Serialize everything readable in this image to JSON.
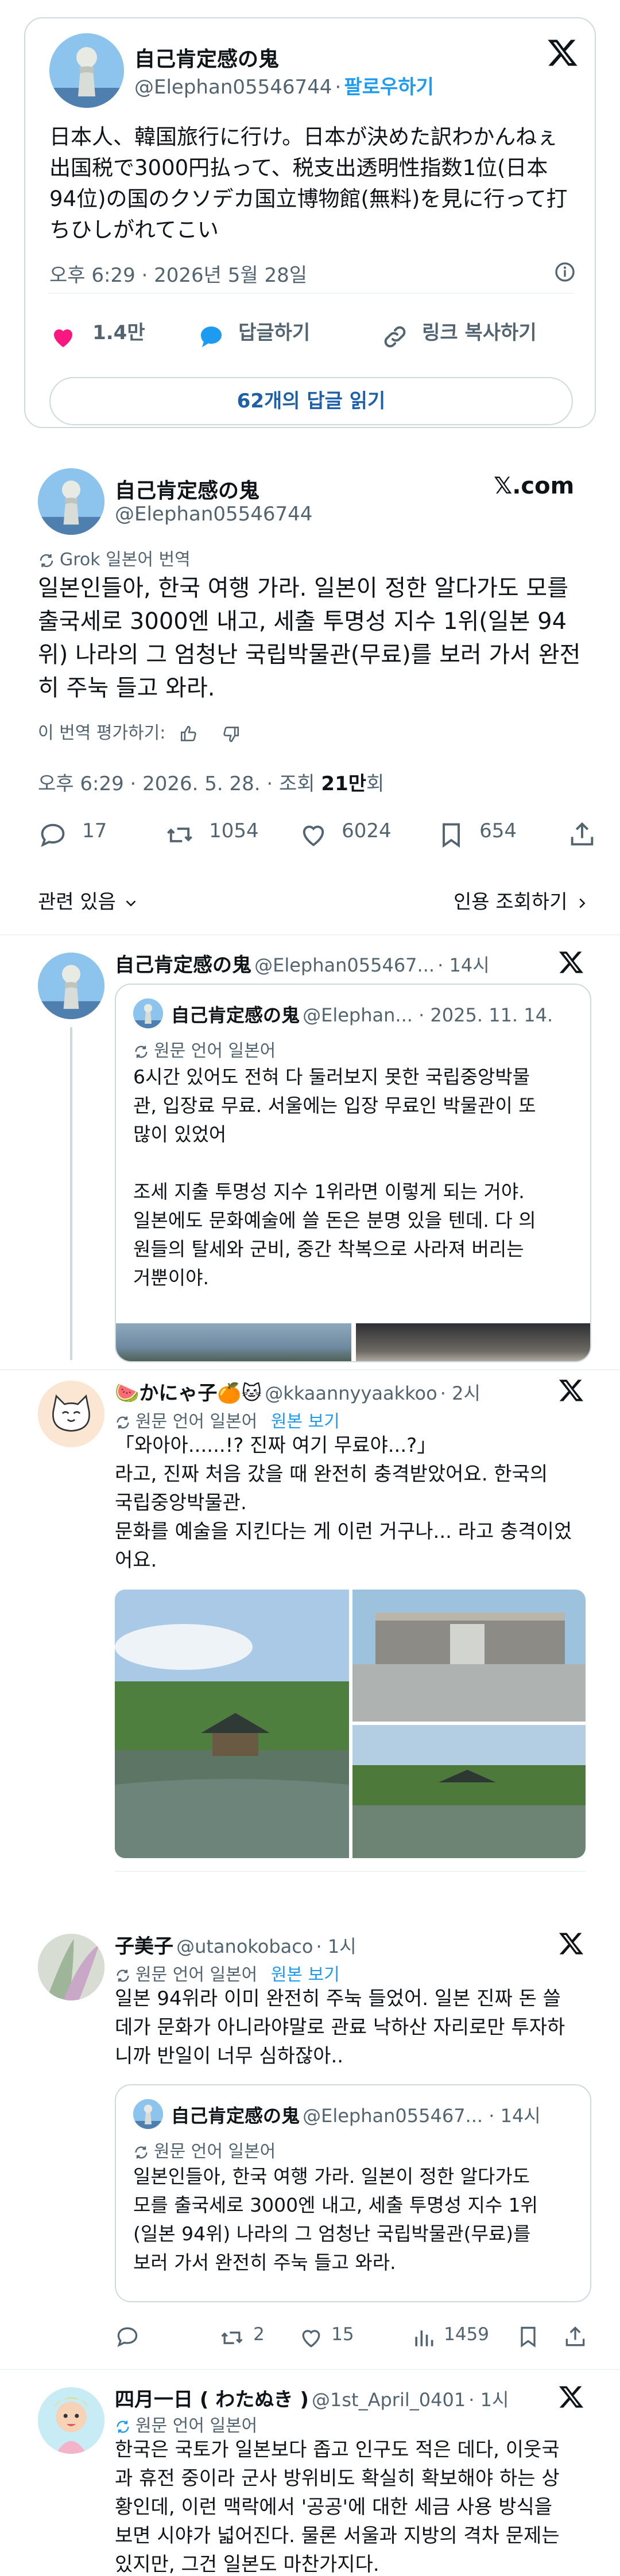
{
  "embed": {
    "author": {
      "name": "自己肯定感の鬼",
      "handle": "@Elephan05546744",
      "sep": "·",
      "follow": "팔로우하기"
    },
    "text_lines": [
      "日本人、韓国旅行に行け。日本が決めた訳わかんねぇ",
      "出国税で3000円払って、税支出透明性指数1位(日本",
      "94位)の国のクソデカ国立博物館(無料)を見に行って打",
      "ちひしがれてこい"
    ],
    "timestamp": "오후 6:29 · 2026년 5월 28일",
    "likes": "1.4만",
    "reply_label": "답글하기",
    "copy_link": "링크 복사하기",
    "read_replies": "62개의 답글 읽기"
  },
  "tweet": {
    "name": "自己肯定感の鬼",
    "handle": "@Elephan05546744",
    "brand": "𝕏.com",
    "grok_note": "Grok 일본어 번역",
    "text_lines": [
      "일본인들아, 한국 여행 가라. 일본이 정한 알다가도 모를",
      "출국세로 3000엔 내고, 세출 투명성 지수 1위(일본 94",
      "위) 나라의 그 엄청난 국립박물관(무료)를 보러 가서 완전",
      "히 주눅 들고 와라."
    ],
    "rate": "이 번역 평가하기:",
    "time_prefix": "오후 6:29 · 2026. 5. 28. · 조회 ",
    "views": "21만",
    "views_suffix": "회",
    "replies": "17",
    "retweets": "1054",
    "likes": "6024",
    "bookmarks": "654",
    "related": "관련 있음",
    "quotes": "인용 조회하기"
  },
  "replies": [
    {
      "name": "自己肯定感の鬼",
      "handle": "@Elephan055467...",
      "time": "· 14시",
      "quote": {
        "name": "自己肯定感の鬼",
        "handle": "@Elephan... · 2025. 11. 14.",
        "note": "원문 언어 일본어",
        "lines": [
          "6시간 있어도 전혀 다 둘러보지 못한 국립중앙박물",
          "관, 입장료 무료. 서울에는 입장 무료인 박물관이 또",
          "많이 있었어",
          "",
          "조세 지출 투명성 지수 1위라면 이렇게 되는 거야.",
          "일본에도 문화예술에 쓸 돈은 분명 있을 텐데. 다 의",
          "원들의 탈세와 군비, 중간 착복으로 사라져 버리는",
          "거뿐이야."
        ]
      }
    },
    {
      "name": "🍉かにゃ子🍊🐱",
      "handle": "@kkaannyyaakkoo",
      "time": "· 2시",
      "note": "원문 언어 일본어",
      "show_original": "원본 보기",
      "lines": [
        "「와아아......!? 진짜 여기 무료야...?」",
        "라고, 진짜 처음 갔을 때 완전히 충격받았어요. 한국의",
        "국립중앙박물관.",
        "문화를 예술을 지킨다는 게 이런 거구나... 라고 충격이었",
        "어요."
      ]
    },
    {
      "name": "子美子",
      "handle": "@utanokobaco",
      "time": "· 1시",
      "note": "원문 언어 일본어",
      "show_original": "원본 보기",
      "lines": [
        "일본 94위라 이미 완전히 주눅 들었어. 일본 진짜 돈 쓸",
        "데가 문화가 아니라야말로 관료 낙하산 자리로만 투자하",
        "니까 반일이 너무 심하잖아.."
      ],
      "quote": {
        "name": "自己肯定感の鬼",
        "handle": "@Elephan055467... · 14시",
        "note": "원문 언어 일본어",
        "lines": [
          "일본인들아, 한국 여행 가라. 일본이 정한 알다가도",
          "모를 출국세로 3000엔 내고, 세출 투명성 지수 1위",
          "(일본 94위) 나라의 그 엄청난 국립박물관(무료)를",
          "보러 가서 완전히 주눅 들고 와라."
        ]
      },
      "retweets": "2",
      "likes": "15",
      "views": "1459"
    },
    {
      "name": "四月一日 ( わたぬき )",
      "handle": "@1st_April_0401",
      "time": "· 1시",
      "note": "원문 언어 일본어",
      "lines": [
        "한국은 국토가 일본보다 좁고 인구도 적은 데다, 이웃국",
        "과 휴전 중이라 군사 방위비도 확실히 확보해야 하는 상",
        "황인데, 이런 맥락에서 '공공'에 대한 세금 사용 방식을",
        "보면 시야가 넓어진다. 물론 서울과 지방의 격차 문제는",
        "있지만, 그건 일본도 마찬가지다."
      ]
    }
  ]
}
